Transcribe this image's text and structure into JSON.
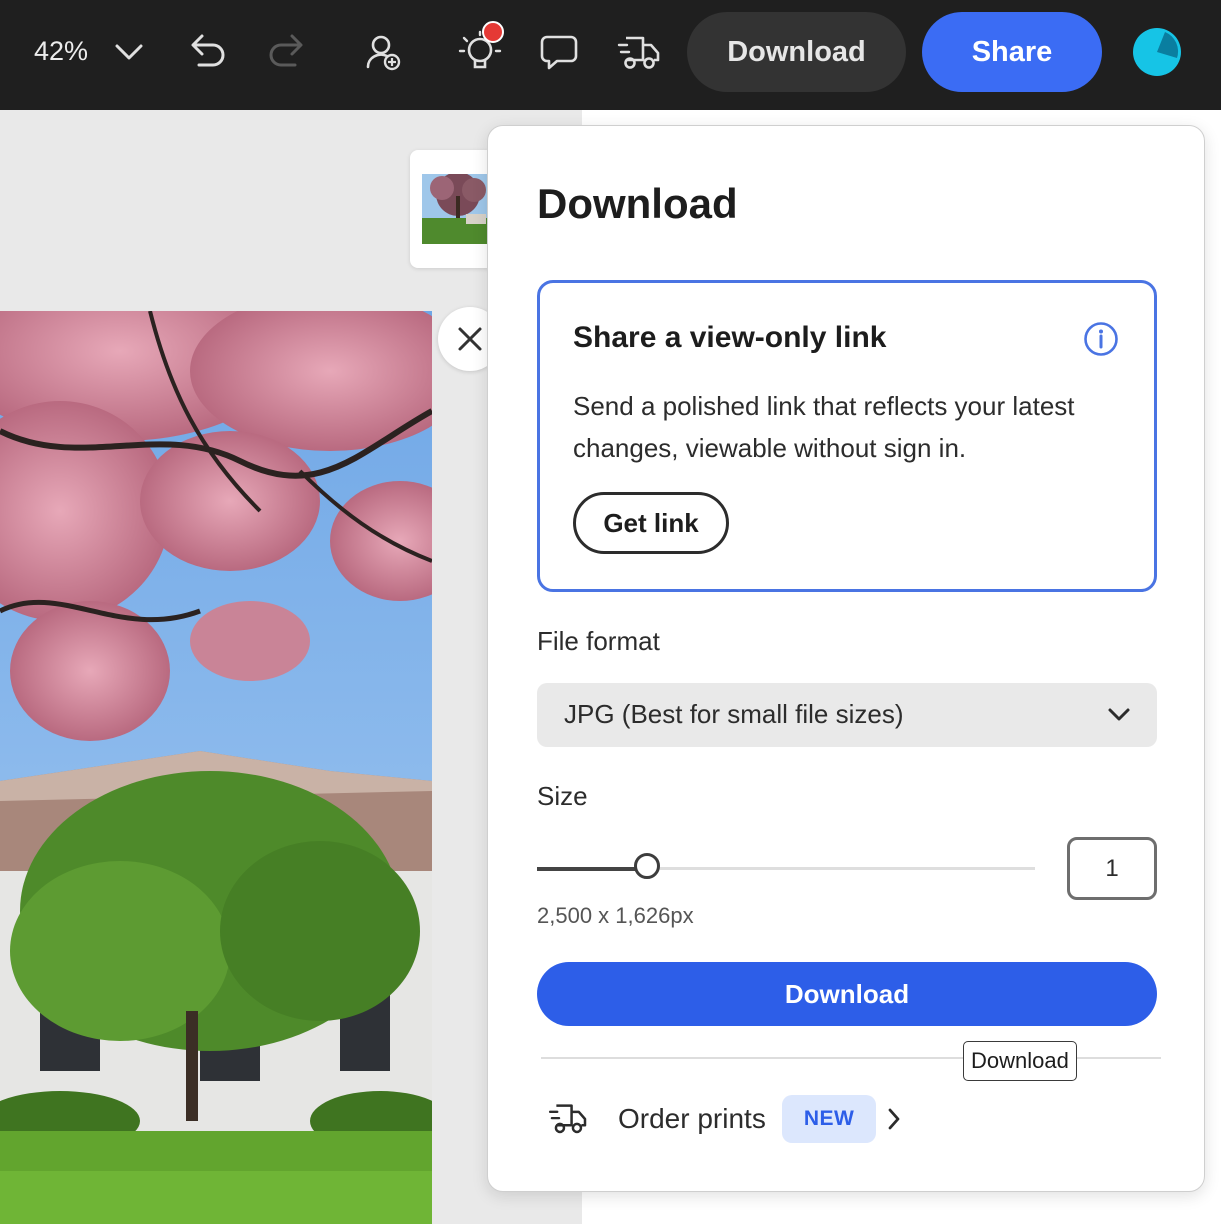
{
  "toolbar": {
    "zoom_level": "42%",
    "icons": [
      "chevron-down-icon",
      "undo-icon",
      "redo-icon",
      "add-collaborator-icon",
      "lightbulb-icon",
      "comment-icon",
      "delivery-truck-icon"
    ],
    "download_label": "Download",
    "share_label": "Share",
    "notification_color": "#e53935",
    "share_color": "#3b6cf4"
  },
  "panel": {
    "title": "Download",
    "link_card": {
      "title": "Share a view-only link",
      "description": "Send a polished link that reflects your latest changes, viewable without sign in.",
      "button_label": "Get link",
      "accent_color": "#4a74e3"
    },
    "file_format": {
      "label": "File format",
      "selected": "JPG (Best for small file sizes)"
    },
    "size": {
      "label": "Size",
      "slider_fraction": 0.22,
      "value": "1",
      "dimensions": "2,500 x 1,626px"
    },
    "download_button_label": "Download",
    "download_button_color": "#2d5ee8",
    "tooltip": "Download",
    "order_prints": {
      "label": "Order prints",
      "badge": "NEW"
    }
  }
}
